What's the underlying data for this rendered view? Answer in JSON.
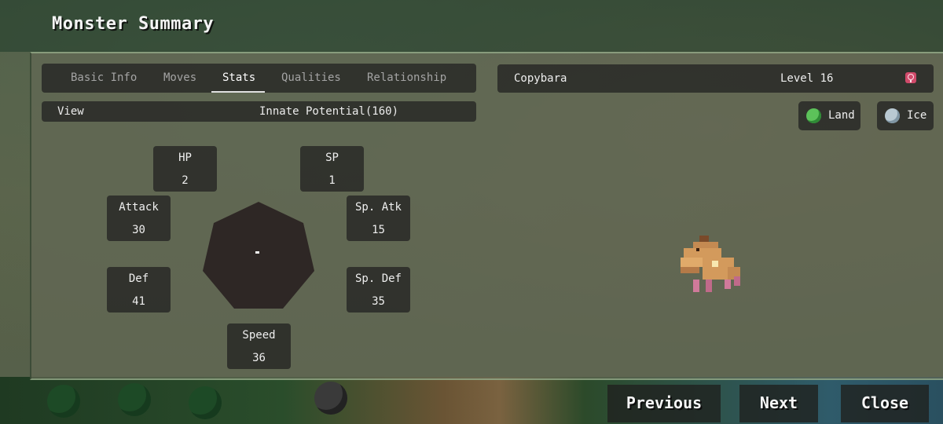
{
  "header": {
    "title": "Monster Summary"
  },
  "tabs": [
    {
      "label": "Basic Info",
      "active": false
    },
    {
      "label": "Moves",
      "active": false
    },
    {
      "label": "Stats",
      "active": true
    },
    {
      "label": "Qualities",
      "active": false
    },
    {
      "label": "Relationship",
      "active": false
    }
  ],
  "view": {
    "label": "View",
    "value": "Innate Potential(160)"
  },
  "stats": {
    "hp": {
      "label": "HP",
      "value": "2"
    },
    "sp": {
      "label": "SP",
      "value": "1"
    },
    "attack": {
      "label": "Attack",
      "value": "30"
    },
    "sp_atk": {
      "label": "Sp. Atk",
      "value": "15"
    },
    "def": {
      "label": "Def",
      "value": "41"
    },
    "sp_def": {
      "label": "Sp. Def",
      "value": "35"
    },
    "speed": {
      "label": "Speed",
      "value": "36"
    }
  },
  "monster": {
    "name": "Copybara",
    "level": "Level 16",
    "gender_icon": "female-icon",
    "types": [
      {
        "label": "Land",
        "icon": "leaf-icon",
        "color": "#5cc25a"
      },
      {
        "label": "Ice",
        "icon": "snowflake-icon",
        "color": "#b9c9d2"
      }
    ]
  },
  "buttons": {
    "previous": "Previous",
    "next": "Next",
    "close": "Close"
  }
}
